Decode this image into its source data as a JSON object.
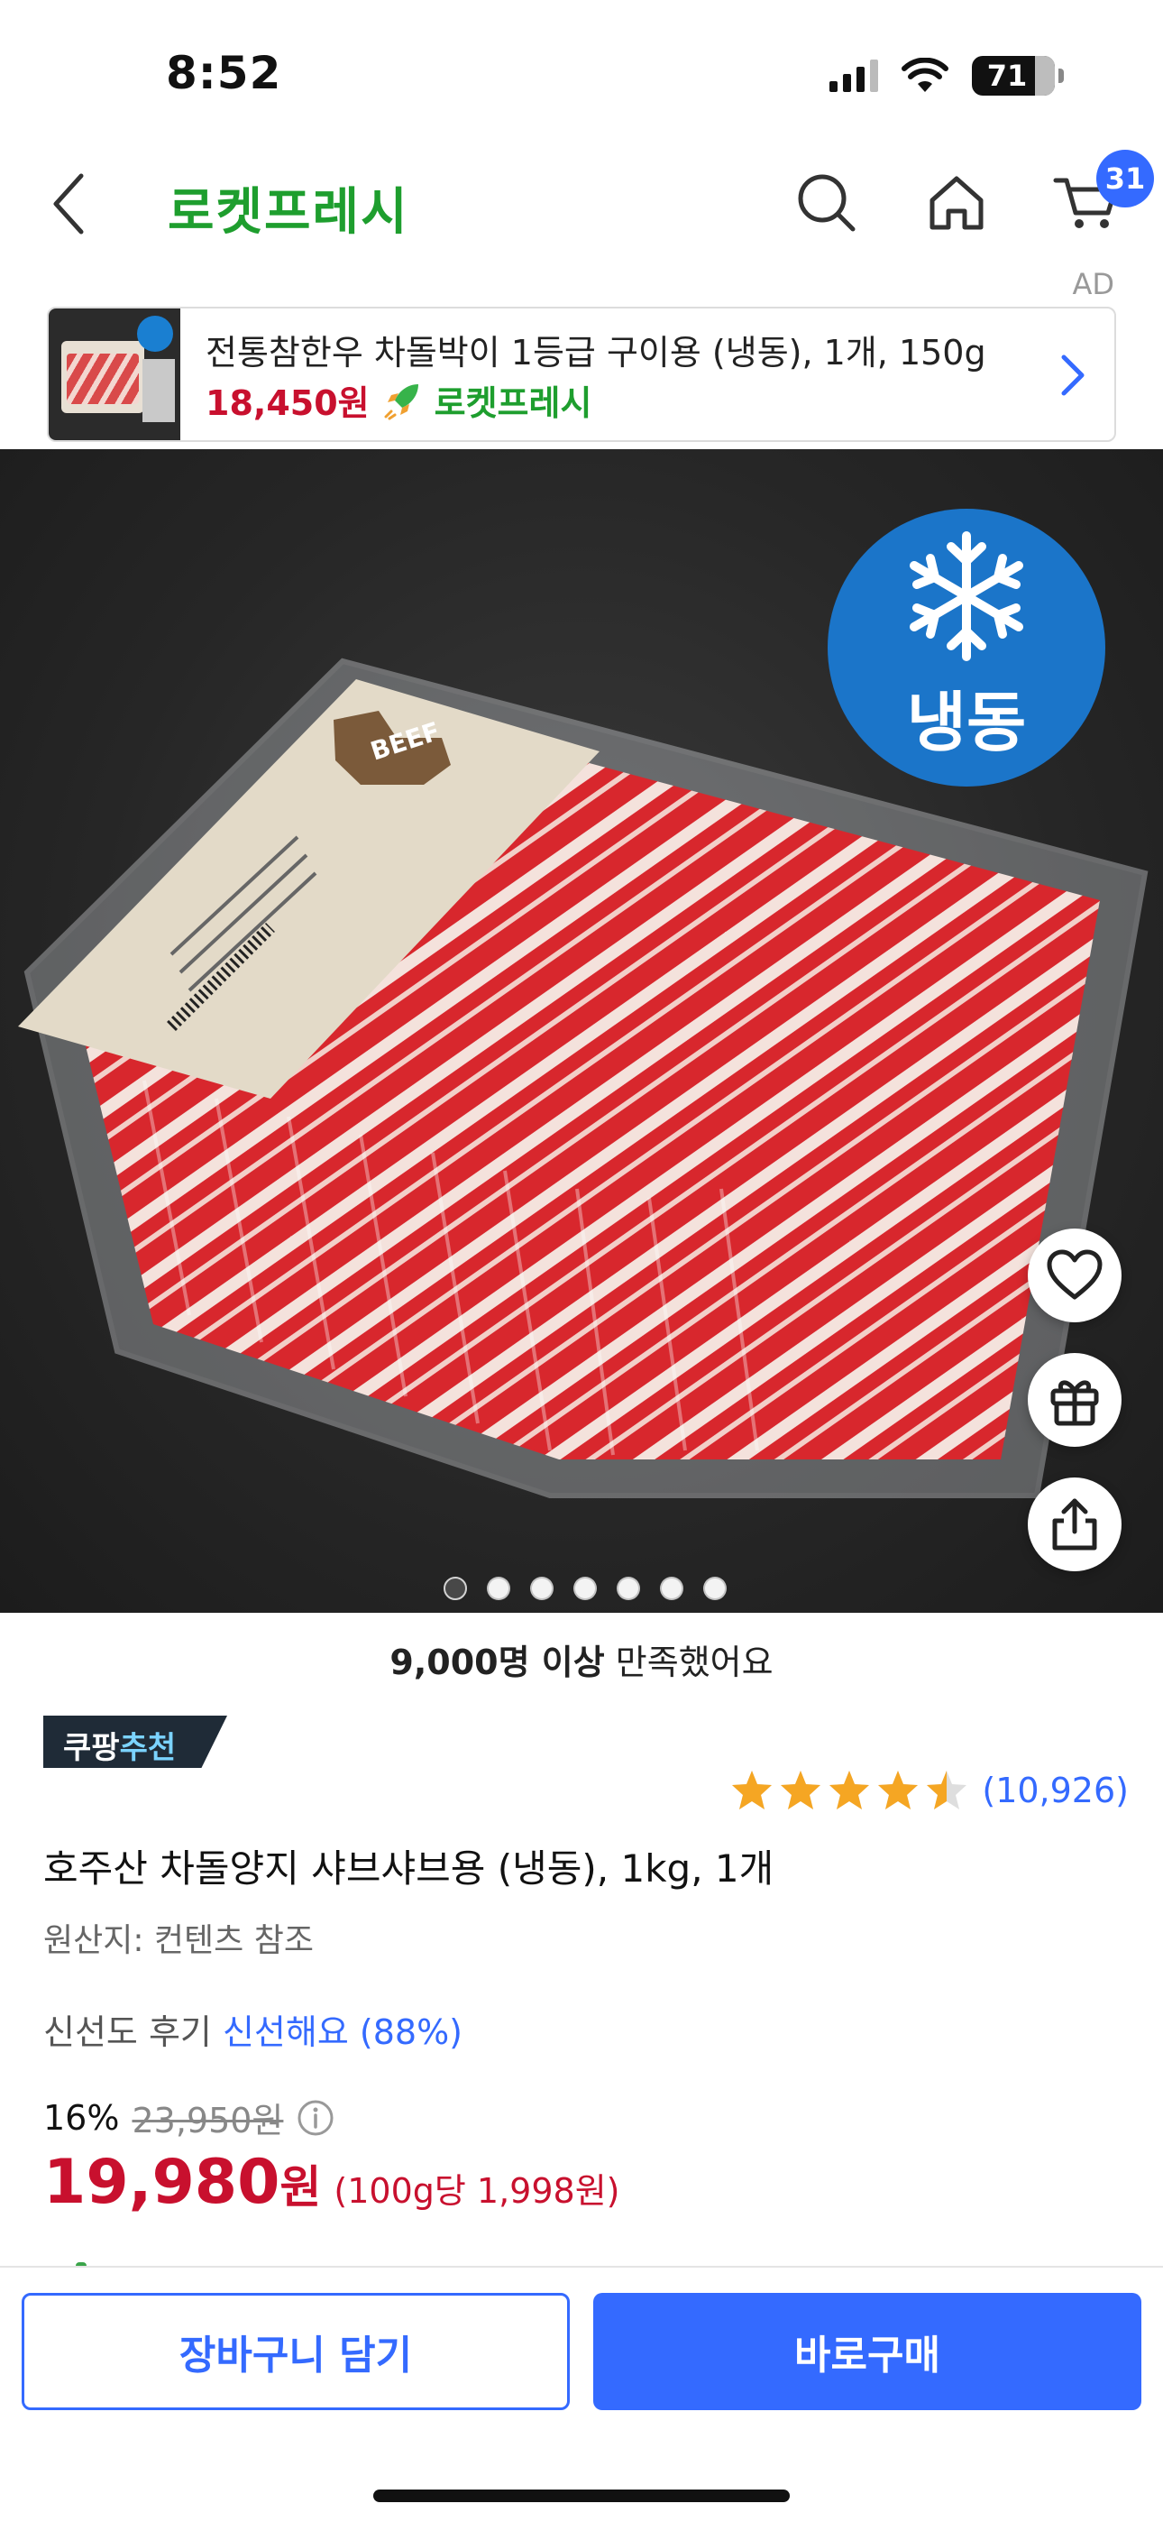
{
  "status_bar": {
    "time": "8:52",
    "battery": "71"
  },
  "nav": {
    "title": "로켓프레시",
    "cart_count": "31"
  },
  "ad": {
    "label": "AD",
    "title": "전통참한우 차돌박이 1등급 구이용 (냉동), 1개, 150g",
    "price": "18,450원",
    "brand": "로켓프레시"
  },
  "image": {
    "frozen_label": "냉동",
    "dot_count": 7,
    "active_dot": 0
  },
  "product": {
    "satisfaction_bold": "9,000명 이상",
    "satisfaction_rest": " 만족했어요",
    "recommend_prefix": "쿠팡",
    "recommend_accent": "추천",
    "rating": 4.5,
    "review_count": "(10,926)",
    "name": "호주산 차돌양지 샤브샤브용 (냉동), 1kg, 1개",
    "origin": "원산지: 컨텐츠 참조",
    "fresh_label": "신선도 후기 ",
    "fresh_value": "신선해요 (88%)",
    "discount_rate": "16%",
    "original_price": "23,950원",
    "sale_price": "19,980",
    "sale_unit": "원",
    "unit_price": "(100g당 1,998원)"
  },
  "actions": {
    "cart_label": "장바구니 담기",
    "buy_label": "바로구매"
  },
  "colors": {
    "brand_green": "#1e9e2e",
    "accent_blue": "#346aff",
    "price_red": "#c8102e",
    "frozen_blue": "#1b75c9"
  }
}
